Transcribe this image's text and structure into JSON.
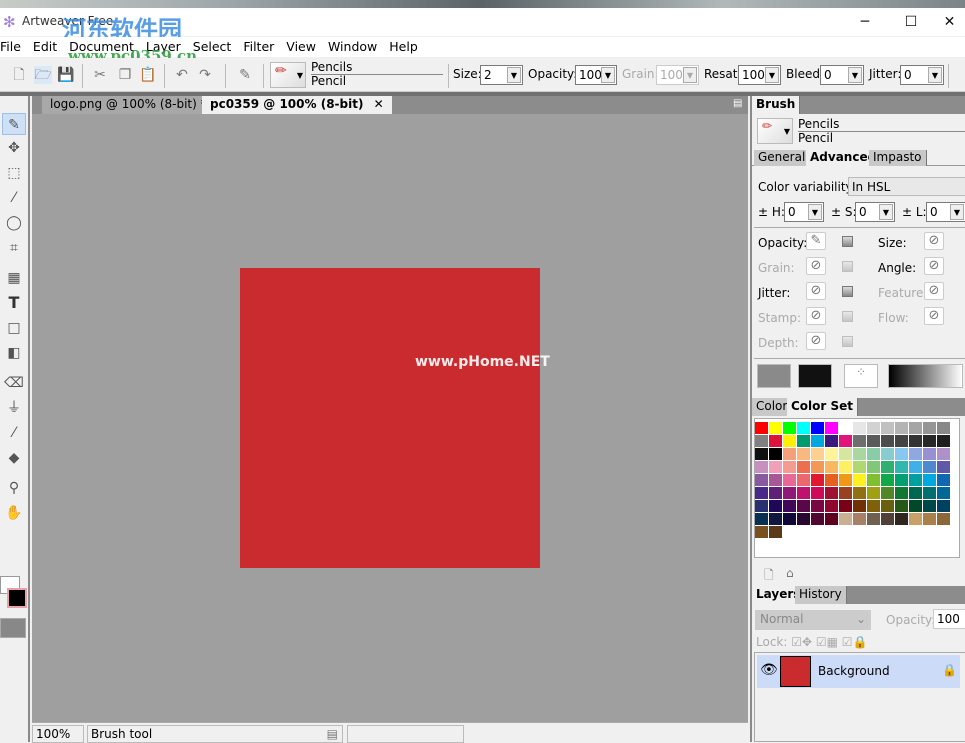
{
  "app": {
    "title": "Artweaver Free",
    "watermark_logo": "河东软件园",
    "watermark_url": "www.pc0359.cn",
    "window_controls": [
      "minimize",
      "maximize",
      "close"
    ]
  },
  "menu": [
    "File",
    "Edit",
    "Document",
    "Layer",
    "Select",
    "Filter",
    "View",
    "Window",
    "Help"
  ],
  "toolbar": {
    "brush_category": "Pencils",
    "brush_name": "Pencil",
    "size_label": "Size:",
    "size": "2",
    "opacity_label": "Opacity:",
    "opacity": "100",
    "grain_label": "Grain:",
    "grain": "100",
    "resat_label": "Resat:",
    "resat": "100",
    "bleed_label": "Bleed:",
    "bleed": "0",
    "jitter_label": "Jitter:",
    "jitter": "0"
  },
  "tabs": [
    {
      "label": "logo.png @ 100% (8-bit) *",
      "active": false
    },
    {
      "label": "pc0359 @ 100% (8-bit)",
      "active": true
    }
  ],
  "canvas": {
    "fill": "#c92b2e",
    "watermark": "www.pHome.NET"
  },
  "status": {
    "zoom": "100%",
    "tool": "Brush tool"
  },
  "brush_panel": {
    "title": "Brush",
    "category": "Pencils",
    "name": "Pencil",
    "tabs": [
      "General",
      "Advanced",
      "Impasto"
    ],
    "active_tab": "Advanced",
    "color_var_label": "Color variability:",
    "color_var": "In HSL",
    "h_label": "± H:",
    "h": "0",
    "s_label": "± S:",
    "s": "0",
    "l_label": "± L:",
    "l": "0",
    "params": [
      "Opacity:",
      "Size:",
      "Grain:",
      "Angle:",
      "Jitter:",
      "Feature:",
      "Stamp:",
      "Flow:",
      "Depth:"
    ]
  },
  "color_panel": {
    "tabs": [
      "Color",
      "Color Set"
    ],
    "active_tab": "Color Set",
    "swatches": [
      "#ff0000",
      "#ffff00",
      "#00ff00",
      "#00ffff",
      "#0000ff",
      "#ff00ff",
      "#ffffff",
      "#e6e6e6",
      "#d2d2d2",
      "#c0c0c0",
      "#b4b4b4",
      "#a5a5a5",
      "#969696",
      "#888888",
      "#808080",
      "#dc143c",
      "#ffef00",
      "#009a70",
      "#00a8e0",
      "#3a1a80",
      "#e0147a",
      "#6e6e6e",
      "#5a5a5a",
      "#4c4c4c",
      "#444444",
      "#333333",
      "#282828",
      "#1e1e1e",
      "#101010",
      "#000000",
      "#f4a07a",
      "#f8b880",
      "#fcd090",
      "#fff49a",
      "#d4e6a0",
      "#a8d8a0",
      "#88cca8",
      "#88ccd0",
      "#88c8f0",
      "#90a8e0",
      "#9890d0",
      "#b090c8",
      "#c890c0",
      "#f0a0b8",
      "#f49c90",
      "#ec7050",
      "#f49858",
      "#f8b860",
      "#fff060",
      "#b0d870",
      "#80c878",
      "#30b070",
      "#30b8b0",
      "#40b0e8",
      "#5088d0",
      "#6058a8",
      "#8858a0",
      "#a85898",
      "#e86898",
      "#ec6870",
      "#e01830",
      "#e86020",
      "#f09818",
      "#fff020",
      "#80c030",
      "#10a848",
      "#00a070",
      "#00a0a0",
      "#00a8e0",
      "#1068b0",
      "#482888",
      "#602078",
      "#901878",
      "#c01070",
      "#d00858",
      "#a01030",
      "#984020",
      "#907010",
      "#a0a010",
      "#508828",
      "#107830",
      "#006850",
      "#007070",
      "#006898",
      "#283070",
      "#200858",
      "#400858",
      "#580848",
      "#780840",
      "#900830",
      "#780018",
      "#703008",
      "#806008",
      "#686010",
      "#285818",
      "#004828",
      "#004848",
      "#004060",
      "#083050",
      "#101840",
      "#100838",
      "#280830",
      "#500830",
      "#600020",
      "#c8b090",
      "#a88068",
      "#706050",
      "#504038",
      "#302820",
      "#c8a068",
      "#a88048",
      "#8c6838",
      "#7a5020",
      "#5a3818"
    ]
  },
  "layers_panel": {
    "tabs": [
      "Layers",
      "History"
    ],
    "active_tab": "Layers",
    "blend_mode": "Normal",
    "opacity_label": "Opacity:",
    "opacity": "100",
    "lock_label": "Lock:",
    "layers": [
      {
        "name": "Background",
        "color": "#c92b2e",
        "visible": true,
        "locked": true
      }
    ]
  }
}
